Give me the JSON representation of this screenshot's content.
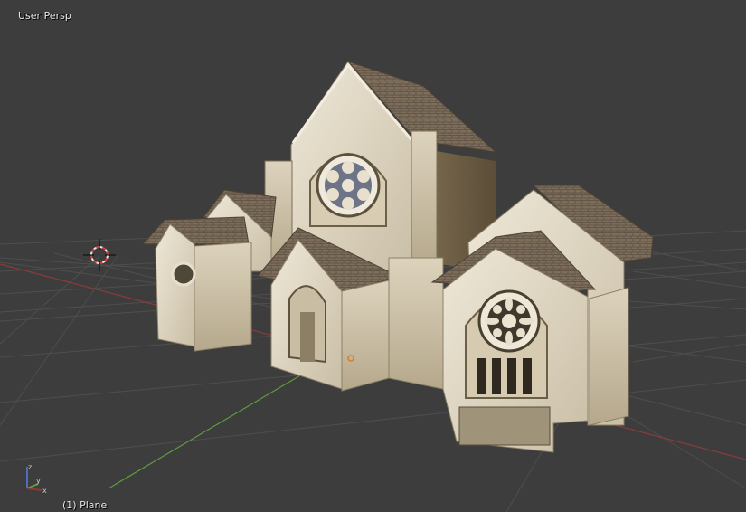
{
  "viewport": {
    "view_name": "User Persp",
    "object_info": "(1) Plane",
    "background_color": "#3d3d3d",
    "grid_color": "#4e4e4e",
    "x_axis_color": "#8a3b3b",
    "y_axis_color": "#5e9a3f",
    "z_axis_color": "#4d6fb8"
  },
  "scene": {
    "object_name": "Plane",
    "model": "gothic-church",
    "cursor": "3d-cursor-icon",
    "origin": "object-origin-icon"
  },
  "axis_gizmo": {
    "axes": [
      "x",
      "y",
      "z"
    ]
  }
}
